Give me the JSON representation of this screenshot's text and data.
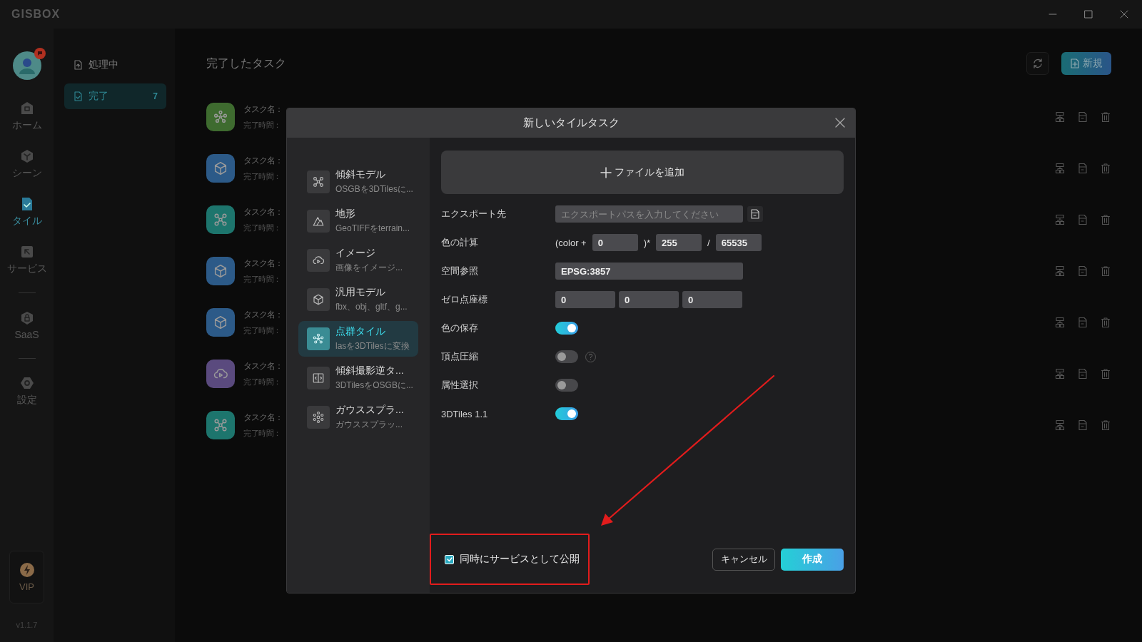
{
  "app": {
    "logo": "GISBOX",
    "version": "v1.1.7"
  },
  "nav": {
    "groups": [
      [
        {
          "label": "ホーム",
          "selected": false
        },
        {
          "label": "シーン",
          "selected": false
        },
        {
          "label": "タイル",
          "selected": true
        },
        {
          "label": "サービス",
          "selected": false
        }
      ],
      [
        {
          "label": "SaaS",
          "selected": false
        }
      ],
      [
        {
          "label": "設定",
          "selected": false
        }
      ]
    ],
    "vip": "VIP"
  },
  "task_panel": {
    "items": [
      {
        "label": "処理中",
        "selected": false
      },
      {
        "label": "完了",
        "count": "7",
        "selected": true
      }
    ]
  },
  "main": {
    "title": "完了したタスク",
    "new_button": "新規",
    "tasks": [
      {
        "kind": "pointcloud",
        "color": "#3e6b2f",
        "name_label": "タスク名：",
        "time_label": "完了時間："
      },
      {
        "kind": "model",
        "color": "#2c5a88",
        "name_label": "タスク名：",
        "time_label": "完了時間："
      },
      {
        "kind": "oblique",
        "color": "#1d756d",
        "name_label": "タスク名：",
        "time_label": "完了時間："
      },
      {
        "kind": "model",
        "color": "#2c5a88",
        "name_label": "タスク名：",
        "time_label": "完了時間："
      },
      {
        "kind": "model",
        "color": "#2c5a88",
        "name_label": "タスク名：",
        "time_label": "完了時間："
      },
      {
        "kind": "image",
        "color": "#5a4a7e",
        "name_label": "タスク名：",
        "time_label": "完了時間："
      },
      {
        "kind": "oblique",
        "color": "#1d756d",
        "name_label": "タスク名：",
        "time_label": "完了時間："
      }
    ]
  },
  "dialog": {
    "title": "新しいタイルタスク",
    "tile_types": [
      {
        "kind": "oblique",
        "title": "傾斜モデル",
        "description": "OSGBを3DTilesに...",
        "selected": false
      },
      {
        "kind": "terrain",
        "title": "地形",
        "description": "GeoTIFFをterrain...",
        "selected": false
      },
      {
        "kind": "image",
        "title": "イメージ",
        "description": "画像をイメージ...",
        "selected": false
      },
      {
        "kind": "model",
        "title": "汎用モデル",
        "description": "fbx、obj、gltf、g...",
        "selected": false
      },
      {
        "kind": "pointcloud",
        "title": "点群タイル",
        "description": "lasを3DTilesに変換",
        "selected": true
      },
      {
        "kind": "reverse",
        "title": "傾斜撮影逆タ...",
        "description": "3DTilesをOSGBに...",
        "selected": false
      },
      {
        "kind": "gauss",
        "title": "ガウススプラ...",
        "description": "ガウススプラッ...",
        "selected": false
      }
    ],
    "add_file": "ファイルを追加",
    "rows": [
      {
        "kind": "path",
        "label": "エクスポート先",
        "placeholder": "エクスポートパスを入力してください"
      },
      {
        "kind": "formula",
        "label": "色の計算",
        "prefix": "(color +",
        "value_1": "0",
        "middle": ")*",
        "value_2": "255",
        "divider": "/",
        "value_3": "65535"
      },
      {
        "kind": "text",
        "label": "空間参照",
        "value": "EPSG:3857"
      },
      {
        "kind": "triple",
        "label": "ゼロ点座標",
        "values": [
          "0",
          "0",
          "0"
        ]
      },
      {
        "kind": "toggle",
        "label": "色の保存",
        "on": true
      },
      {
        "kind": "toggle",
        "label": "頂点圧縮",
        "on": false,
        "help": "?"
      },
      {
        "kind": "toggle",
        "label": "属性選択",
        "on": false
      },
      {
        "kind": "toggle",
        "label": "3DTiles 1.1",
        "on": true
      }
    ],
    "publish": {
      "label": "同時にサービスとして公開",
      "checked": true
    },
    "cancel_button": "キャンセル",
    "create_button": "作成"
  }
}
